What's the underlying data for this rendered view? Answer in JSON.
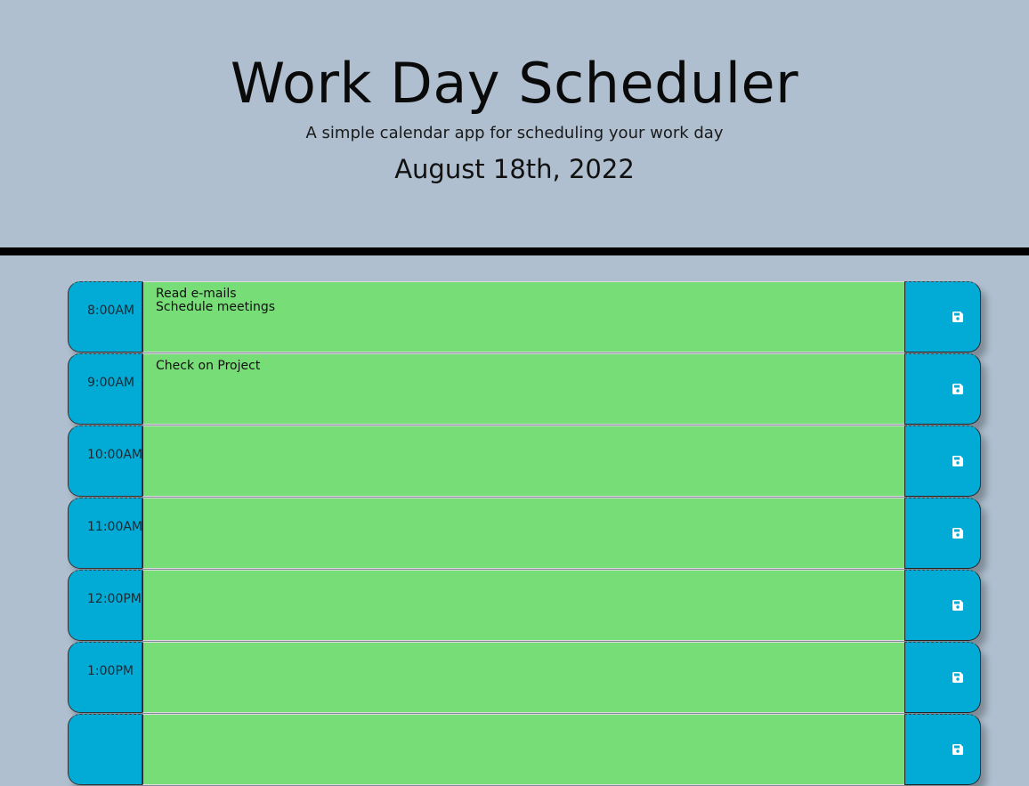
{
  "header": {
    "title": "Work Day Scheduler",
    "subtitle": "A simple calendar app for scheduling your work day",
    "current_day": "August 18th, 2022"
  },
  "colors": {
    "background": "#afbfcf",
    "present": "#77dd77",
    "hour_block": "#02abd6",
    "divider": "#000000",
    "save_icon": "#ffffff"
  },
  "schedule": {
    "rows": [
      {
        "hour": "8:00AM",
        "task": "Read e-mails\nSchedule meetings",
        "save_icon": "floppy-disk-icon"
      },
      {
        "hour": "9:00AM",
        "task": "Check on Project",
        "save_icon": "floppy-disk-icon"
      },
      {
        "hour": "10:00AM",
        "task": "",
        "save_icon": "floppy-disk-icon"
      },
      {
        "hour": "11:00AM",
        "task": "",
        "save_icon": "floppy-disk-icon"
      },
      {
        "hour": "12:00PM",
        "task": "",
        "save_icon": "floppy-disk-icon"
      },
      {
        "hour": "1:00PM",
        "task": "",
        "save_icon": "floppy-disk-icon"
      },
      {
        "hour": "",
        "task": "",
        "save_icon": "floppy-disk-icon"
      }
    ]
  }
}
